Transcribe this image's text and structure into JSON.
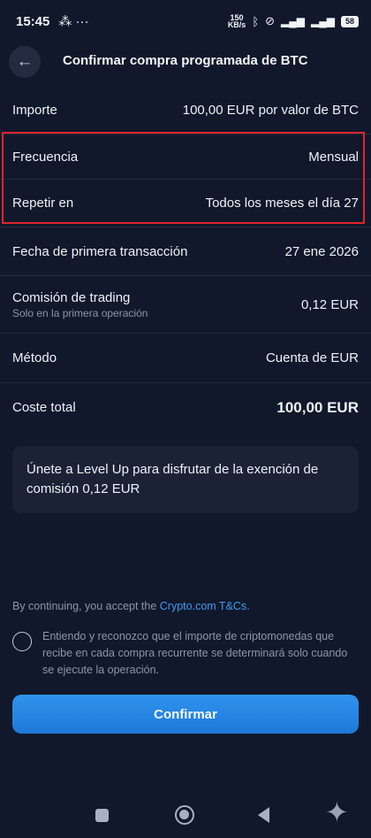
{
  "status_bar": {
    "time": "15:45",
    "left_icons": "⁂ ···",
    "speed_value": "150",
    "speed_unit": "KB/s",
    "battery": "58"
  },
  "header": {
    "title": "Confirmar compra programada de BTC"
  },
  "rows": {
    "importe": {
      "label": "Importe",
      "value": "100,00 EUR por valor de BTC"
    },
    "frecuencia": {
      "label": "Frecuencia",
      "value": "Mensual"
    },
    "repetir": {
      "label": "Repetir en",
      "value": "Todos los meses el día 27"
    },
    "fecha": {
      "label": "Fecha de primera transacción",
      "value": "27 ene 2026"
    },
    "comision": {
      "label": "Comisión de trading",
      "sublabel": "Solo en la primera operación",
      "value": "0,12 EUR"
    },
    "metodo": {
      "label": "Método",
      "value": "Cuenta de EUR"
    },
    "coste": {
      "label": "Coste total",
      "value": "100,00 EUR"
    }
  },
  "promo": {
    "text": "Únete a Level Up para disfrutar de la exención de comisión 0,12 EUR"
  },
  "terms": {
    "prefix": "By continuing, you accept the ",
    "link": "Crypto.com T&Cs",
    "suffix": "."
  },
  "consent": {
    "text": "Entiendo y reconozco que el importe de criptomonedas que recibe en cada compra recurrente se determinará solo cuando se ejecute la operación."
  },
  "confirm_button": {
    "label": "Confirmar"
  },
  "colors": {
    "background": "#11182b",
    "accent": "#2f93ee",
    "link": "#3d9bf5",
    "highlight": "#e0242d"
  }
}
